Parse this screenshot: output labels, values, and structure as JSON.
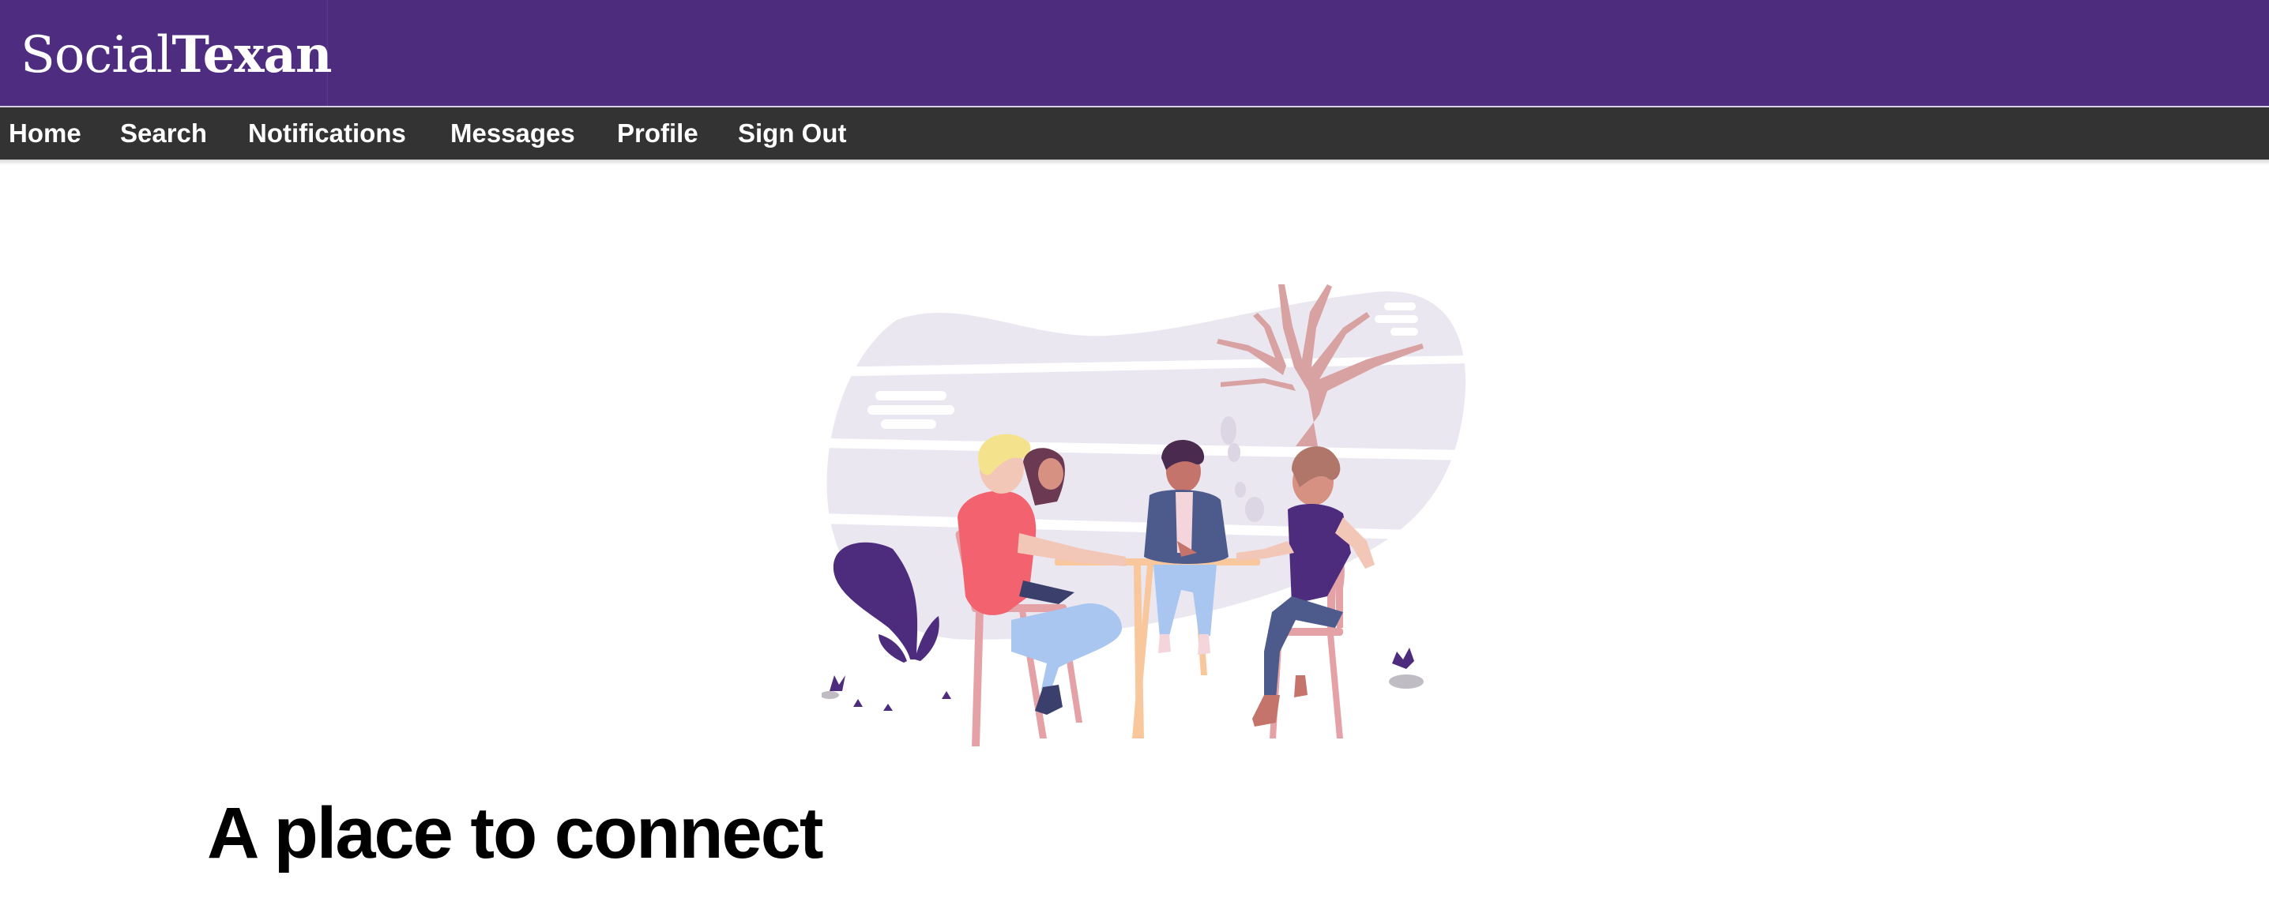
{
  "brand": {
    "light": "Social",
    "bold": "Texan"
  },
  "nav": {
    "items": [
      {
        "label": "Home"
      },
      {
        "label": "Search"
      },
      {
        "label": "Notifications"
      },
      {
        "label": "Messages"
      },
      {
        "label": "Profile"
      },
      {
        "label": "Sign Out"
      }
    ]
  },
  "hero": {
    "illustration": "people-at-table-illustration",
    "headline": "A place to connect"
  },
  "colors": {
    "header_bg": "#4d2c7e",
    "navbar_bg": "#333333",
    "accent": "#4d2c7e"
  }
}
